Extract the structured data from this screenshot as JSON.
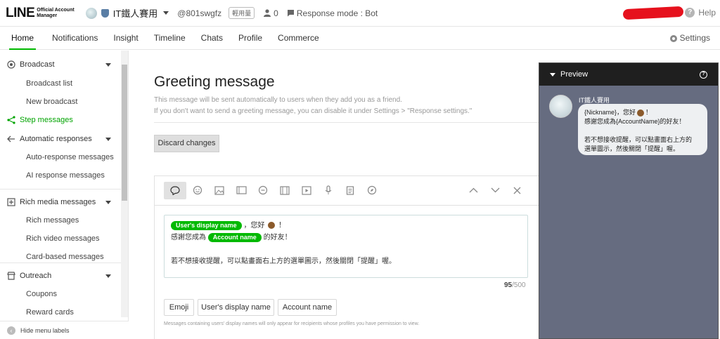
{
  "header": {
    "logo_main": "LINE",
    "logo_sub_1": "Official Account",
    "logo_sub_2": "Manager",
    "account_name": "IT鐵人賽用",
    "account_id": "@801swgfz",
    "plan_badge": "輕用量",
    "friends_count": "0",
    "response_mode": "Response mode : Bot",
    "help_label": "Help"
  },
  "nav": {
    "tabs": [
      "Home",
      "Notifications",
      "Insight",
      "Timeline",
      "Chats",
      "Profile",
      "Commerce"
    ],
    "active_tab": "Home",
    "settings_label": "Settings"
  },
  "sidebar": {
    "broadcast": "Broadcast",
    "broadcast_list": "Broadcast list",
    "new_broadcast": "New broadcast",
    "step_messages": "Step messages",
    "automatic_responses": "Automatic responses",
    "auto_response_messages": "Auto-response messages",
    "ai_response_messages": "AI response messages",
    "rich_media_messages": "Rich media messages",
    "rich_messages": "Rich messages",
    "rich_video_messages": "Rich video messages",
    "card_based_messages": "Card-based messages",
    "outreach": "Outreach",
    "coupons": "Coupons",
    "reward_cards": "Reward cards",
    "hide_menu_labels": "Hide menu labels"
  },
  "main": {
    "title": "Greeting message",
    "desc_line1": "This message will be sent automatically to users when they add you as a friend.",
    "desc_line2": "If you don't want to send a greeting message, you can disable it under Settings > \"Response settings.\"",
    "discard_label": "Discard changes",
    "editor": {
      "chip_display_name": "User's display name",
      "chip_account_name": "Account name",
      "line1_after_chip": "，您好",
      "line1_end": "！",
      "line2_prefix": "感謝您成為",
      "line2_suffix": "的好友！",
      "line3": "若不想接收提醒，可以點畫面右上方的選單圖示，然後關閉「提醒」喔。",
      "char_count": "95",
      "char_max": "/500"
    },
    "insert_buttons": {
      "emoji": "Emoji",
      "display_name": "User's display name",
      "account_name": "Account name"
    },
    "note": "Messages containing users' display names will only appear for recipients whose profiles you have permission to view."
  },
  "preview": {
    "title": "Preview",
    "sender": "IT鐵人賽用",
    "bubble_l1a": "{Nickname}，您好",
    "bubble_l1b": "！",
    "bubble_l2": "感謝您成為{AccountName}的好友！",
    "bubble_l3": "若不想接收提醒，可以點畫面右上方的",
    "bubble_l4": "選單圖示，然後關閉「提醒」喔。"
  },
  "colors": {
    "brand_green": "#00b900",
    "preview_bg": "#666c80",
    "preview_header": "#1f1f1f",
    "redaction": "#e6111d"
  }
}
